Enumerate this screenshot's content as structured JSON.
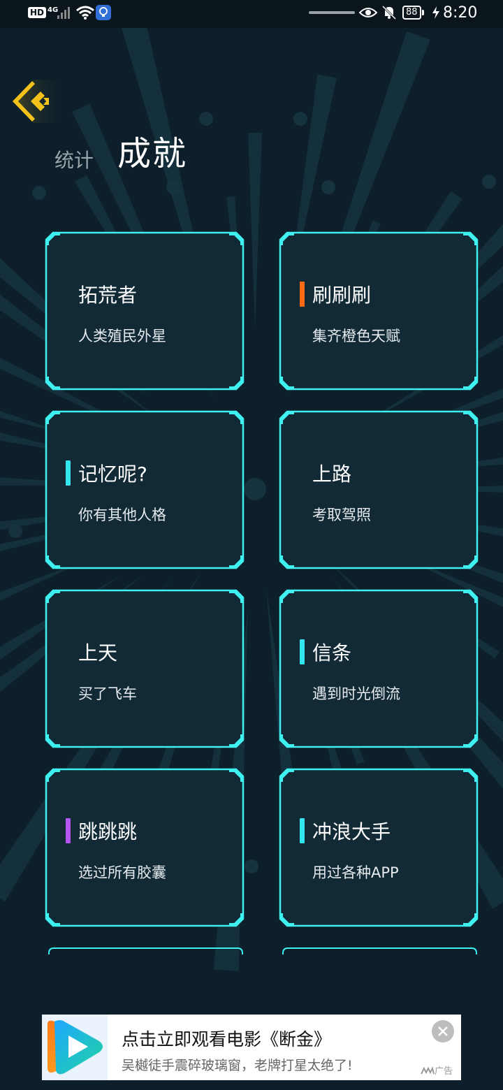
{
  "status_bar": {
    "hd": "HD",
    "network": "4G",
    "battery": "88",
    "time": "8:20",
    "icons": [
      "signal-icon",
      "wifi-icon",
      "bulb-icon",
      "eye-icon",
      "bell-off-icon",
      "charging-icon"
    ]
  },
  "nav": {
    "back_icon": "back-chevron-icon",
    "tabs": [
      {
        "label": "统计",
        "active": false
      },
      {
        "label": "成就",
        "active": true
      }
    ]
  },
  "achievements": [
    {
      "title": "拓荒者",
      "desc": "人类殖民外星",
      "marker": null
    },
    {
      "title": "刷刷刷",
      "desc": "集齐橙色天赋",
      "marker": "#ff6a13"
    },
    {
      "title": "记忆呢?",
      "desc": "你有其他人格",
      "marker": "#33e6ee"
    },
    {
      "title": "上路",
      "desc": "考取驾照",
      "marker": null
    },
    {
      "title": "上天",
      "desc": "买了飞车",
      "marker": null
    },
    {
      "title": "信条",
      "desc": "遇到时光倒流",
      "marker": "#33e6ee"
    },
    {
      "title": "跳跳跳",
      "desc": "选过所有胶囊",
      "marker": "#b455f0"
    },
    {
      "title": "冲浪大手",
      "desc": "用过各种APP",
      "marker": "#33e6ee"
    }
  ],
  "ad": {
    "title": "点击立即观看电影《断金》",
    "subtitle": "吴樾徒手震碎玻璃窗，老牌打星太绝了!",
    "tag": "广告",
    "logo": "video-play-logo",
    "close_icon": "close-icon"
  },
  "colors": {
    "background": "#0d1f2a",
    "card_fill": "#112a36",
    "card_border": "#3ff0f0",
    "back_button": "#f2c21b"
  }
}
